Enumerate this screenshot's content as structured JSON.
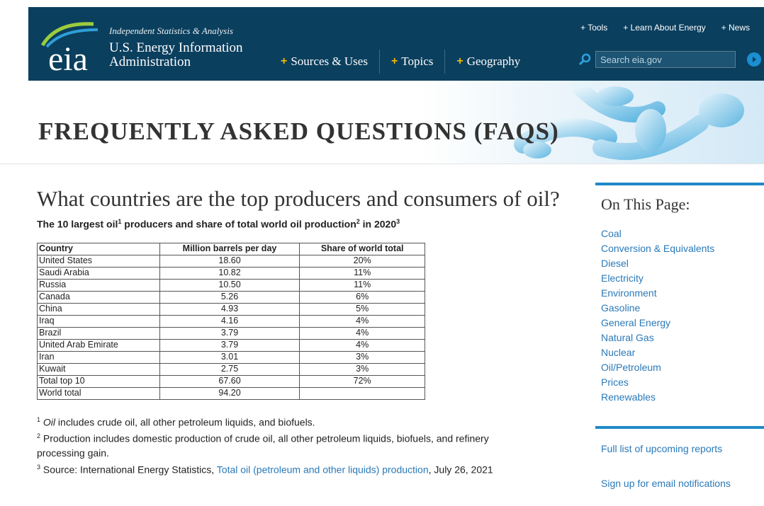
{
  "header": {
    "logo_text": "eia",
    "tagline": "Independent Statistics & Analysis",
    "agency_line1": "U.S. Energy Information",
    "agency_line2": "Administration",
    "main_nav": [
      "Sources & Uses",
      "Topics",
      "Geography"
    ],
    "top_nav": [
      "+ Tools",
      "+ Learn About Energy",
      "+ News"
    ],
    "search_placeholder": "Search eia.gov",
    "colors": {
      "header_bg": "#0b3f5e",
      "accent_plus": "#f2b705",
      "link": "#2a79b8"
    }
  },
  "banner": {
    "title": "FREQUENTLY ASKED QUESTIONS (FAQS)"
  },
  "main": {
    "question": "What countries are the top producers and consumers of oil?",
    "caption": {
      "part1": "The 10 largest oil",
      "sup1": "1",
      "part2": " producers and share of total world oil production",
      "sup2": "2",
      "part3": " in 2020",
      "sup3": "3"
    },
    "table": {
      "headers": [
        "Country",
        "Million barrels per day",
        "Share of world total"
      ],
      "rows": [
        [
          "United States",
          "18.60",
          "20%"
        ],
        [
          "Saudi Arabia",
          "10.82",
          "11%"
        ],
        [
          "Russia",
          "10.50",
          "11%"
        ],
        [
          "Canada",
          "5.26",
          "6%"
        ],
        [
          "China",
          "4.93",
          "5%"
        ],
        [
          "Iraq",
          "4.16",
          "4%"
        ],
        [
          "Brazil",
          "3.79",
          "4%"
        ],
        [
          "United Arab Emirate",
          "3.79",
          "4%"
        ],
        [
          "Iran",
          "3.01",
          "3%"
        ],
        [
          "Kuwait",
          "2.75",
          "3%"
        ],
        [
          "Total top 10",
          "67.60",
          "72%"
        ],
        [
          "World total",
          "94.20",
          ""
        ]
      ]
    },
    "footnotes": {
      "f1_sup": "1",
      "f1_italic": "Oil",
      "f1_text": " includes crude oil, all other petroleum liquids, and biofuels.",
      "f2_sup": "2",
      "f2_text": " Production includes domestic production of crude oil, all other petroleum liquids, biofuels, and refinery processing gain.",
      "f3_sup": "3",
      "f3_prefix": " Source: International Energy Statistics, ",
      "f3_link": "Total oil (petroleum and other liquids) production",
      "f3_suffix": ", July 26, 2021"
    }
  },
  "sidebar": {
    "title": "On This Page:",
    "items": [
      "Coal",
      "Conversion & Equivalents",
      "Diesel",
      "Electricity",
      "Environment",
      "Gasoline",
      "General Energy",
      "Natural Gas",
      "Nuclear",
      "Oil/Petroleum",
      "Prices",
      "Renewables"
    ],
    "reports_link": "Full list of upcoming reports",
    "signup_link": "Sign up for email notifications"
  }
}
